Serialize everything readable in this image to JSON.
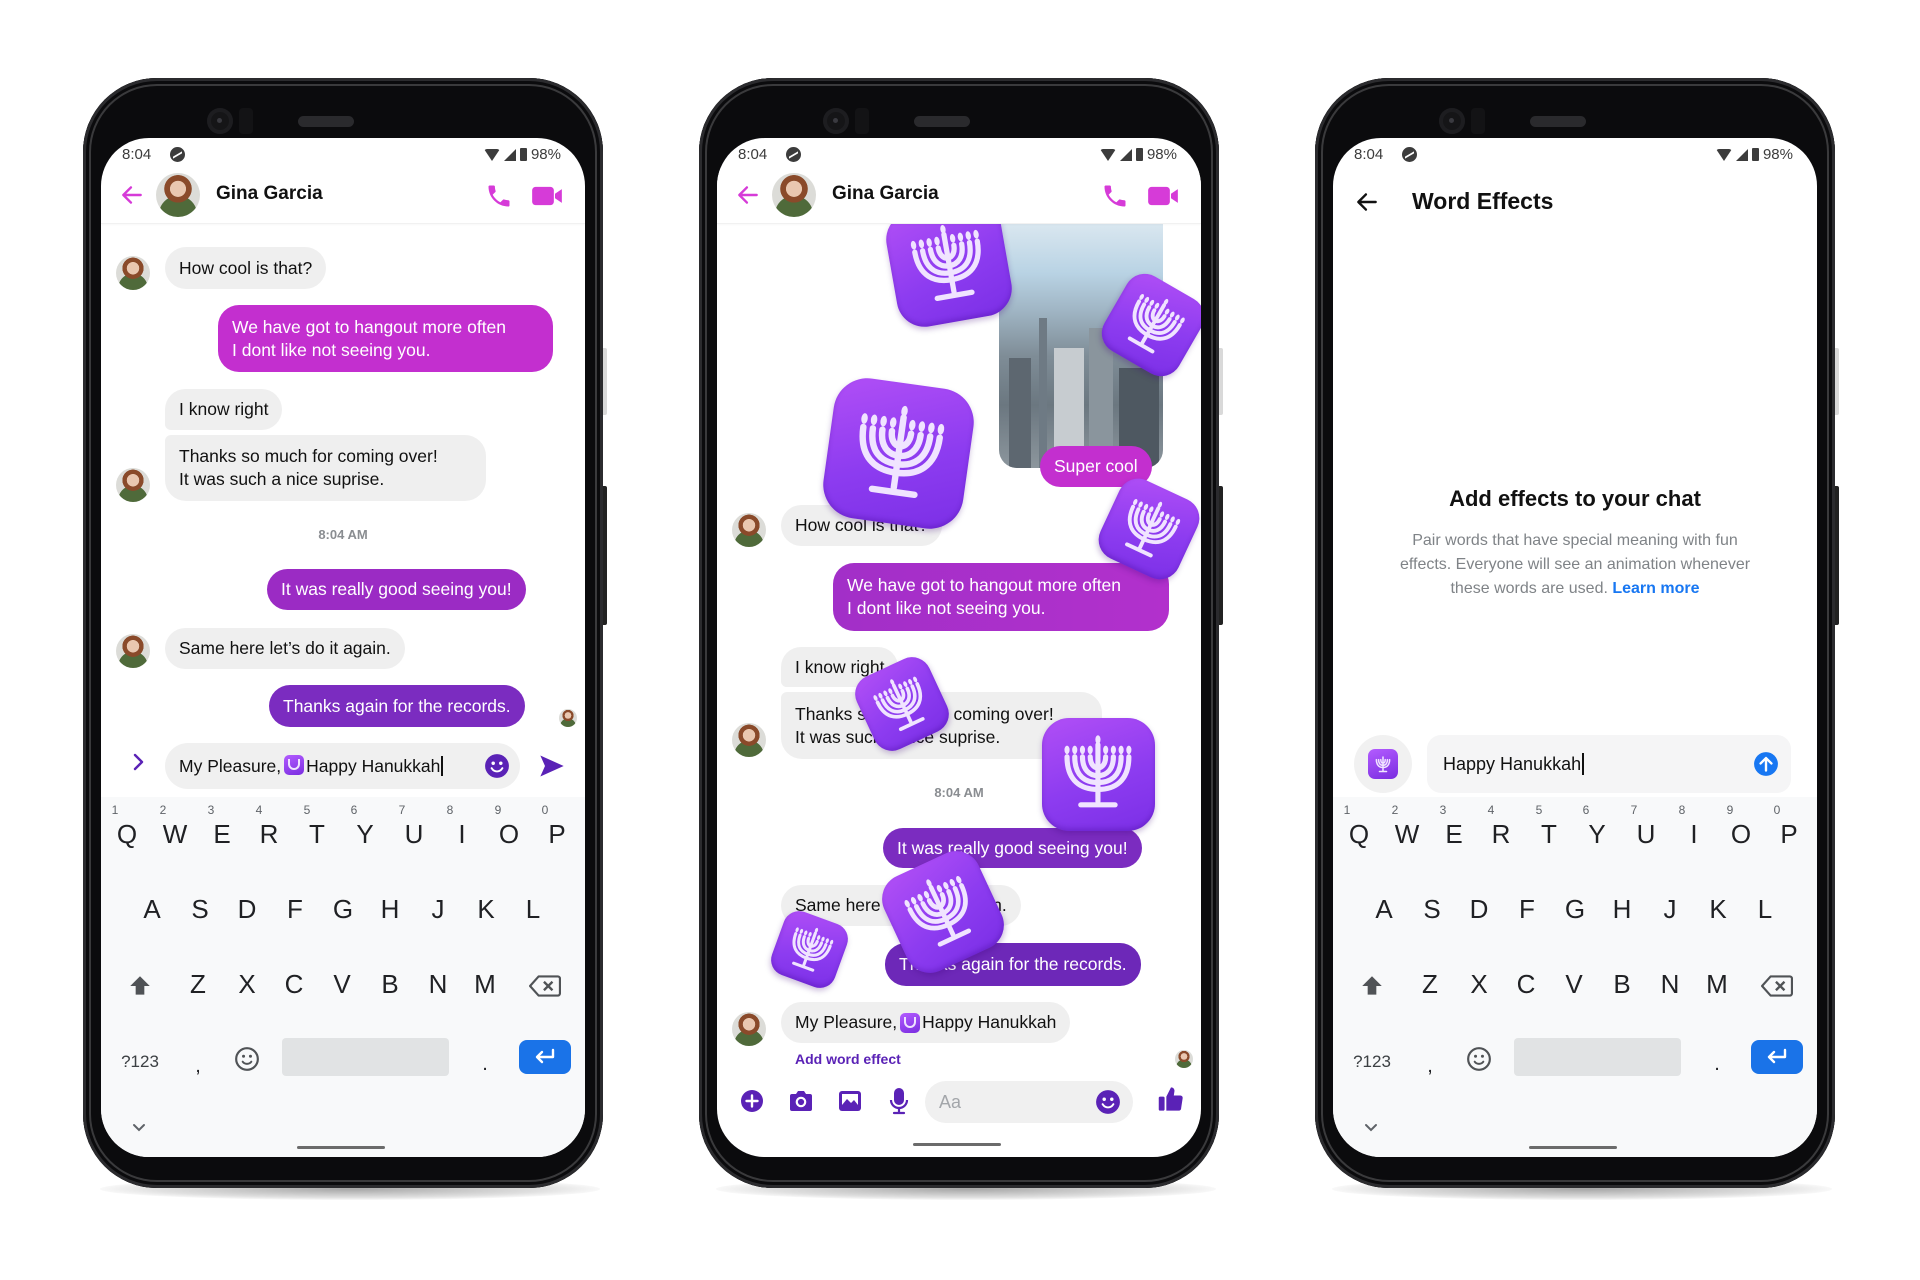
{
  "status_bar": {
    "time": "8:04",
    "battery": "98%"
  },
  "contact": {
    "name": "Gina Garcia"
  },
  "colors": {
    "accent_magenta": "#d63bd8",
    "messenger_purple": "#5a22b6",
    "link_blue": "#1877f2",
    "enter_blue": "#1a73e8"
  },
  "phone1": {
    "messages": [
      {
        "from": "them",
        "text": "How cool is that?"
      },
      {
        "from": "me",
        "lines": [
          "We have got to hangout more often",
          "I dont like not seeing you."
        ]
      },
      {
        "from": "them",
        "text": "I know right"
      },
      {
        "from": "them",
        "lines": [
          "Thanks so much for coming over!",
          "It was such a nice suprise."
        ]
      },
      {
        "type": "timestamp",
        "text": "8:04 AM"
      },
      {
        "from": "me",
        "text": "It was really good seeing you!"
      },
      {
        "from": "them",
        "text": "Same here let’s do it again."
      },
      {
        "from": "me",
        "text": "Thanks again for the records."
      }
    ],
    "composer": {
      "prefix": "My Pleasure,",
      "suffix": "Happy Hanukkah"
    }
  },
  "phone2": {
    "messages": [
      {
        "from": "me",
        "type": "image",
        "caption": "Super cool"
      },
      {
        "from": "them",
        "text": "How cool is that?"
      },
      {
        "from": "me",
        "lines": [
          "We have got to hangout more often",
          "I dont like not seeing you."
        ]
      },
      {
        "from": "them",
        "text": "I know right"
      },
      {
        "from": "them",
        "lines": [
          "Thanks so much for coming over!",
          "It was such a nice suprise."
        ]
      },
      {
        "type": "timestamp",
        "text": "8:04 AM"
      },
      {
        "from": "me",
        "text": "It was really good seeing you!"
      },
      {
        "from": "them",
        "text": "Same here let’s do it again."
      },
      {
        "from": "me",
        "text": "Thanks again for the records."
      },
      {
        "from": "them",
        "prefix": "My Pleasure,",
        "suffix": "Happy Hanukkah"
      }
    ],
    "add_word_effect": "Add word effect",
    "composer": {
      "placeholder": "Aa"
    },
    "toolbar_icons": [
      "plus-icon",
      "camera-icon",
      "gallery-icon",
      "microphone-icon",
      "emoji-icon",
      "thumbs-up-icon"
    ],
    "effect_emoji": "menorah"
  },
  "phone3": {
    "title": "Word Effects",
    "heading": "Add effects to your chat",
    "description_lines": [
      "Pair words that have special meaning with fun",
      "effects. Everyone will see an animation whenever",
      "these words are used."
    ],
    "learn_more": "Learn more",
    "input_value": "Happy Hanukkah"
  },
  "keyboard": {
    "row1": [
      "Q",
      "W",
      "E",
      "R",
      "T",
      "Y",
      "U",
      "I",
      "O",
      "P"
    ],
    "row1_numbers": [
      "1",
      "2",
      "3",
      "4",
      "5",
      "6",
      "7",
      "8",
      "9",
      "0"
    ],
    "row2": [
      "A",
      "S",
      "D",
      "F",
      "G",
      "H",
      "J",
      "K",
      "L"
    ],
    "row3": [
      "Z",
      "X",
      "C",
      "V",
      "B",
      "N",
      "M"
    ],
    "symbols_key": "?123",
    "comma": ",",
    "period": "."
  }
}
